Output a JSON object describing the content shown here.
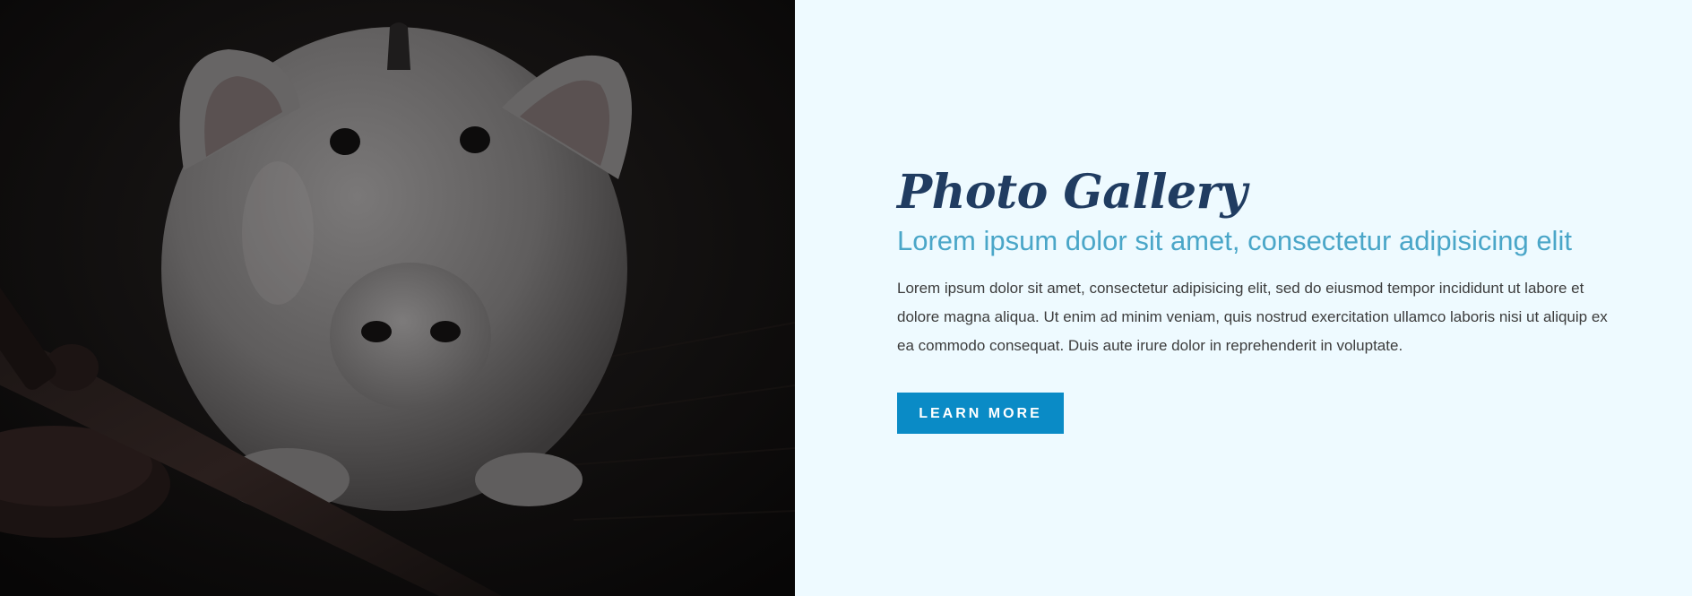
{
  "section": {
    "title": "Photo Gallery",
    "subtitle": "Lorem ipsum dolor sit amet, consectetur adipisicing elit",
    "body": "Lorem ipsum dolor sit amet, consectetur adipisicing elit, sed do eiusmod tempor incididunt ut labore et dolore magna aliqua. Ut enim ad minim veniam, quis nostrud exercitation ullamco laboris nisi ut aliquip ex ea commodo consequat. Duis aute irure dolor in reprehenderit in voluptate.",
    "button_label": "LEARN MORE"
  },
  "image": {
    "subject": "piggy-bank-and-gavel"
  },
  "colors": {
    "title": "#203c61",
    "subtitle": "#4aa6c8",
    "button": "#0a8bc6",
    "background": "#eefaff"
  }
}
